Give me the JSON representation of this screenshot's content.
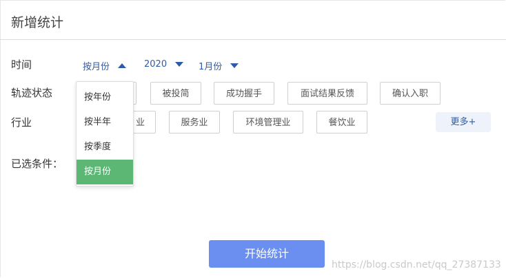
{
  "page": {
    "title": "新增统计"
  },
  "time": {
    "label": "时间",
    "period_value": "按月份",
    "year_value": "2020",
    "month_value": "1月份",
    "period_options": [
      "按年份",
      "按半年",
      "按季度",
      "按月份"
    ],
    "selected_option": "按月份"
  },
  "track_status": {
    "label": "轨迹状态",
    "chips": [
      "被投简",
      "成功握手",
      "面试结果反馈",
      "确认入职"
    ]
  },
  "industry": {
    "label": "行业",
    "chips": [
      "业",
      "服务业",
      "环境管理业",
      "餐饮业"
    ],
    "more_label": "更多+"
  },
  "selected": {
    "label": "已选条件："
  },
  "start_button": "开始统计",
  "watermark": "https://blog.csdn.net/qq_27387133",
  "colors": {
    "accent": "#2e5aa7",
    "active_option": "#5cb774",
    "primary_button": "#6a8ff0",
    "more_bg": "#eef2fb"
  }
}
